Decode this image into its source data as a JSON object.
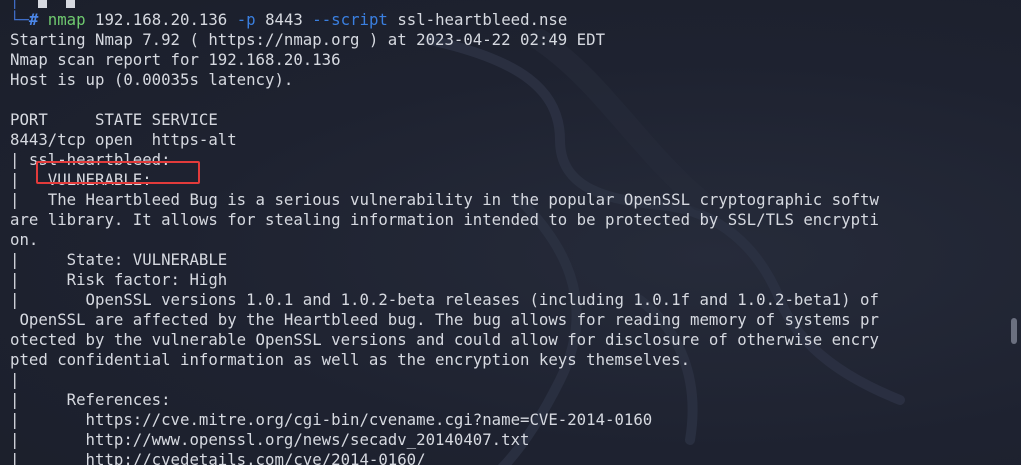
{
  "prompt": {
    "tree_glyph": "└─",
    "symbol": "#",
    "command": "nmap",
    "target": "192.168.20.136",
    "port_flag": "-p",
    "port": "8443",
    "script_flag": "--script",
    "script": "ssl-heartbleed.nse"
  },
  "output_lines": [
    "Starting Nmap 7.92 ( https://nmap.org ) at 2023-04-22 02:49 EDT",
    "Nmap scan report for 192.168.20.136",
    "Host is up (0.00035s latency).",
    "",
    "PORT     STATE SERVICE",
    "8443/tcp open  https-alt",
    "| ssl-heartbleed:",
    "|   VULNERABLE:",
    "|   The Heartbleed Bug is a serious vulnerability in the popular OpenSSL cryptographic softw",
    "are library. It allows for stealing information intended to be protected by SSL/TLS encrypti",
    "on.",
    "|     State: VULNERABLE",
    "|     Risk factor: High",
    "|       OpenSSL versions 1.0.1 and 1.0.2-beta releases (including 1.0.1f and 1.0.2-beta1) of",
    " OpenSSL are affected by the Heartbleed bug. The bug allows for reading memory of systems pr",
    "otected by the vulnerable OpenSSL versions and could allow for disclosure of otherwise encry",
    "pted confidential information as well as the encryption keys themselves.",
    "|",
    "|     References:",
    "|       https://cve.mitre.org/cgi-bin/cvename.cgi?name=CVE-2014-0160",
    "|       http://www.openssl.org/news/secadv_20140407.txt",
    "|_      http://cvedetails.com/cve/2014-0160/"
  ],
  "colors": {
    "background": "#1f2330",
    "text": "#d6d9e0",
    "prompt_tree": "#3f6ec9",
    "command": "#6fc96f",
    "option": "#3a7fe0",
    "highlight": "#e23b3b"
  }
}
